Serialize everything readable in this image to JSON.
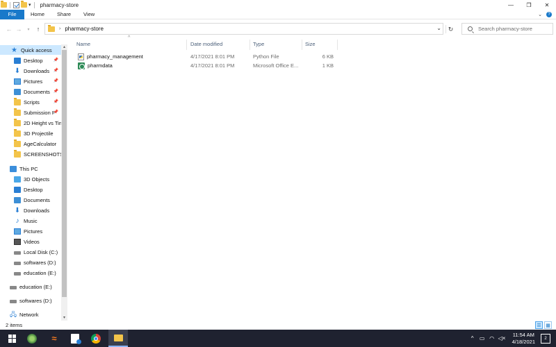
{
  "window": {
    "title": "pharmacy-store",
    "minimize": "—",
    "maximize": "❐",
    "close": "✕"
  },
  "ribbon": {
    "file": "File",
    "tabs": [
      "Home",
      "Share",
      "View"
    ]
  },
  "address": {
    "path": "pharmacy-store",
    "search_placeholder": "Search pharmacy-store"
  },
  "columns": {
    "name": "Name",
    "date": "Date modified",
    "type": "Type",
    "size": "Size"
  },
  "files": [
    {
      "name": "pharmacy_management",
      "date": "4/17/2021 8:01 PM",
      "type": "Python File",
      "size": "6 KB",
      "icon": "python-file-icon"
    },
    {
      "name": "pharmdata",
      "date": "4/17/2021 8:01 PM",
      "type": "Microsoft Office E...",
      "size": "1 KB",
      "icon": "access-database-icon"
    }
  ],
  "sidebar": {
    "quick_access": "Quick access",
    "quick_items": [
      "Desktop",
      "Downloads",
      "Pictures",
      "Documents",
      "Scripts",
      "Submission P",
      "2D Height vs Tim",
      "3D Projectile",
      "AgeCalculator",
      "SCREENSHOTS"
    ],
    "this_pc": "This PC",
    "pc_items": [
      "3D Objects",
      "Desktop",
      "Documents",
      "Downloads",
      "Music",
      "Pictures",
      "Videos",
      "Local Disk (C:)",
      "softwares (D:)",
      "education (E:)"
    ],
    "drives": [
      "education (E:)",
      "softwares (D:)"
    ],
    "network": "Network"
  },
  "status": {
    "count": "2 items"
  },
  "taskbar": {
    "time": "11:54 AM",
    "date": "4/18/2021",
    "notifications": "2"
  }
}
